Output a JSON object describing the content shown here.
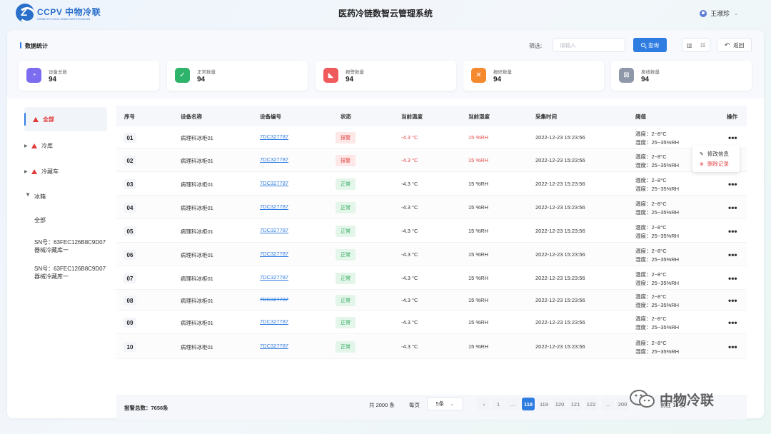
{
  "header": {
    "logo_title": "CCPV 中物冷联",
    "logo_sub": "CHINA IOT COLD CHAIN CERTIFICATION",
    "app_title": "医药冷链数智云管理系统",
    "user_name": "王淑珍"
  },
  "section": {
    "title": "数据统计"
  },
  "filter": {
    "label": "筛选:",
    "placeholder": "请输入",
    "query_label": "查询",
    "back_label": "返回"
  },
  "stats": [
    {
      "label": "设备总数",
      "value": "94",
      "icon": "pie-chart-icon",
      "color": "#7c6cf0"
    },
    {
      "label": "正常数量",
      "value": "94",
      "icon": "check-square-icon",
      "color": "#2db36a"
    },
    {
      "label": "报警数量",
      "value": "94",
      "icon": "alarm-chart-icon",
      "color": "#ef5a5a"
    },
    {
      "label": "报修数量",
      "value": "94",
      "icon": "repair-tools-icon",
      "color": "#f5892e"
    },
    {
      "label": "离线数量",
      "value": "94",
      "icon": "offline-x-icon",
      "color": "#8f98a8"
    }
  ],
  "sidebar": {
    "items": [
      {
        "label": "全部"
      },
      {
        "label": "冷库"
      },
      {
        "label": "冷藏车"
      },
      {
        "label": "冰箱"
      }
    ],
    "sub_items": [
      {
        "label": "全部"
      },
      {
        "label": "SN号：63FEC126B8C9D07 器械冷藏库一"
      },
      {
        "label": "SN号：63FEC126B8C9D07 器械冷藏库一"
      }
    ]
  },
  "table": {
    "headers": [
      "序号",
      "设备名称",
      "设备编号",
      "状态",
      "当前温度",
      "当前湿度",
      "采集时间",
      "阈值",
      "操作"
    ],
    "rows": [
      {
        "no": "01",
        "name": "病理科冰柜01",
        "code": "7DC327787",
        "status": "报警",
        "temp": "-4.3 °C",
        "humidity": "15 %RH",
        "time": "2022-12-23 15:23:56",
        "thr_temp": "温度：2~8°C",
        "thr_hum": "湿度：25~35%RH"
      },
      {
        "no": "02",
        "name": "病理科冰柜01",
        "code": "7DC327787",
        "status": "报警",
        "temp": "-4.3 °C",
        "humidity": "15 %RH",
        "time": "2022-12-23 15:23:56",
        "thr_temp": "温度：2~8°C",
        "thr_hum": "湿度：25~35%RH"
      },
      {
        "no": "03",
        "name": "病理科冰柜01",
        "code": "7DC327787",
        "status": "正常",
        "temp": "-4.3 °C",
        "humidity": "15 %RH",
        "time": "2022-12-23 15:23:56",
        "thr_temp": "温度：2~8°C",
        "thr_hum": "湿度：25~35%RH"
      },
      {
        "no": "04",
        "name": "病理科冰柜01",
        "code": "7DC327787",
        "status": "正常",
        "temp": "-4.3 °C",
        "humidity": "15 %RH",
        "time": "2022-12-23 15:23:56",
        "thr_temp": "温度：2~8°C",
        "thr_hum": "湿度：25~35%RH"
      },
      {
        "no": "05",
        "name": "病理科冰柜01",
        "code": "7DC327787",
        "status": "正常",
        "temp": "-4.3 °C",
        "humidity": "15 %RH",
        "time": "2022-12-23 15:23:56",
        "thr_temp": "温度：2~8°C",
        "thr_hum": "湿度：25~35%RH"
      },
      {
        "no": "06",
        "name": "病理科冰柜01",
        "code": "7DC327787",
        "status": "正常",
        "temp": "-4.3 °C",
        "humidity": "15 %RH",
        "time": "2022-12-23 15:23:56",
        "thr_temp": "温度：2~8°C",
        "thr_hum": "湿度：25~35%RH"
      },
      {
        "no": "07",
        "name": "病理科冰柜01",
        "code": "7DC327787",
        "status": "正常",
        "temp": "-4.3 °C",
        "humidity": "15 %RH",
        "time": "2022-12-23 15:23:56",
        "thr_temp": "温度：2~8°C",
        "thr_hum": "湿度：25~35%RH"
      },
      {
        "no": "08",
        "name": "病理科冰柜01",
        "code": "7DC327787",
        "status": "正常",
        "temp": "-4.3 °C",
        "humidity": "15 %RH",
        "time": "2022-12-23 15:23:56",
        "thr_temp": "温度：2~8°C",
        "thr_hum": "湿度：25~35%RH"
      },
      {
        "no": "09",
        "name": "病理科冰柜01",
        "code": "7DC327787",
        "status": "正常",
        "temp": "-4.3 °C",
        "humidity": "15 %RH",
        "time": "2022-12-23 15:23:56",
        "thr_temp": "温度：2~8°C",
        "thr_hum": "湿度：25~35%RH"
      },
      {
        "no": "10",
        "name": "病理科冰柜01",
        "code": "7DC327787",
        "status": "正常",
        "temp": "-4.3 °C",
        "humidity": "15 %RH",
        "time": "2022-12-23 15:23:56",
        "thr_temp": "温度：2~8°C",
        "thr_hum": "湿度：25~35%RH"
      }
    ],
    "footer": "报警总数：7656条",
    "menu": {
      "edit": "修改信息",
      "delete": "删除记录"
    }
  },
  "pagination": {
    "total": "共 2000 条",
    "per_page_label": "每页",
    "page_size": "5条",
    "pages": [
      "1",
      "...",
      "118",
      "119",
      "120",
      "121",
      "122",
      "...",
      "200"
    ],
    "current": "118",
    "tail": "前往  18  页"
  },
  "watermark": {
    "text": "中物冷联"
  }
}
